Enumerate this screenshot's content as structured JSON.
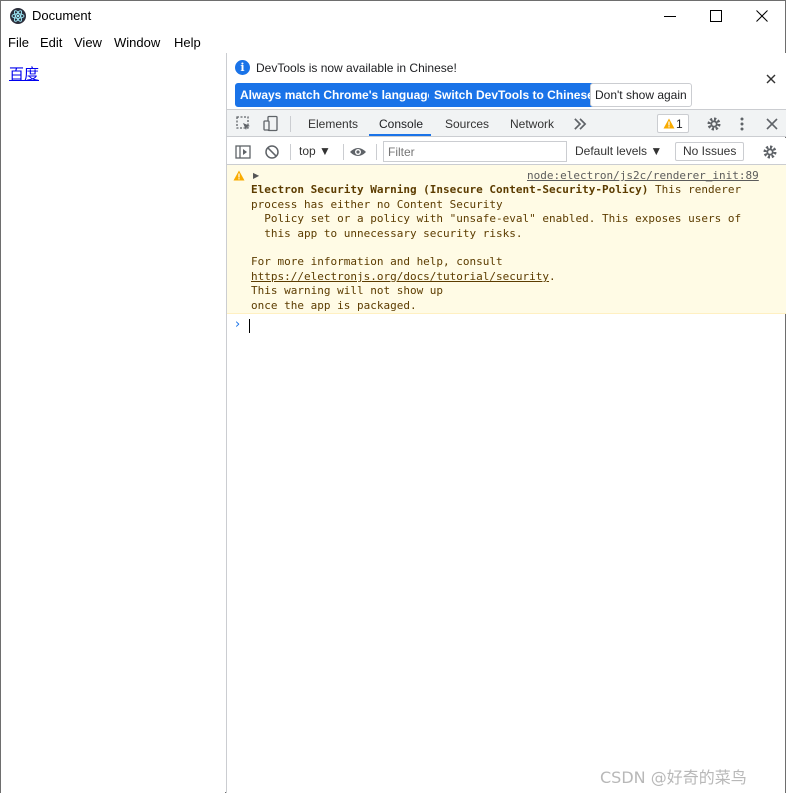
{
  "window": {
    "title": "Document",
    "icon": "electron-icon",
    "controls": [
      "minimize-icon",
      "maximize-icon",
      "close-icon"
    ]
  },
  "menu": {
    "items": [
      "File",
      "Edit",
      "View",
      "Window",
      "Help"
    ]
  },
  "page": {
    "link_text": "百度"
  },
  "devtools": {
    "infobar": {
      "message": "DevTools is now available in Chinese!",
      "btn_match": "Always match Chrome's language",
      "btn_switch": "Switch DevTools to Chinese",
      "btn_dont_show": "Don't show again"
    },
    "tabs": [
      "Elements",
      "Console",
      "Sources",
      "Network"
    ],
    "active_tab": "Console",
    "warning_count": "1",
    "console_toolbar": {
      "context": "top",
      "filter_placeholder": "Filter",
      "levels": "Default levels",
      "issues": "No Issues"
    },
    "warning": {
      "source": "node:electron/js2c/renderer_init:89",
      "title": "Electron Security Warning (Insecure Content-Security-Policy)",
      "line1_rest": " This renderer",
      "line2": "process has either no Content Security",
      "line3": "  Policy set or a policy with \"unsafe-eval\" enabled. This exposes users of",
      "line4": "  this app to unnecessary security risks.",
      "line5": "For more information and help, consult",
      "link": "https://electronjs.org/docs/tutorial/security",
      "link_suffix": ".",
      "line7": "This warning will not show up",
      "line8": "once the app is packaged."
    }
  },
  "watermark": "CSDN @好奇的菜鸟",
  "colors": {
    "accent": "#1a73e8",
    "warning_bg": "#fffbe5",
    "warning_text": "#5c3c00"
  }
}
